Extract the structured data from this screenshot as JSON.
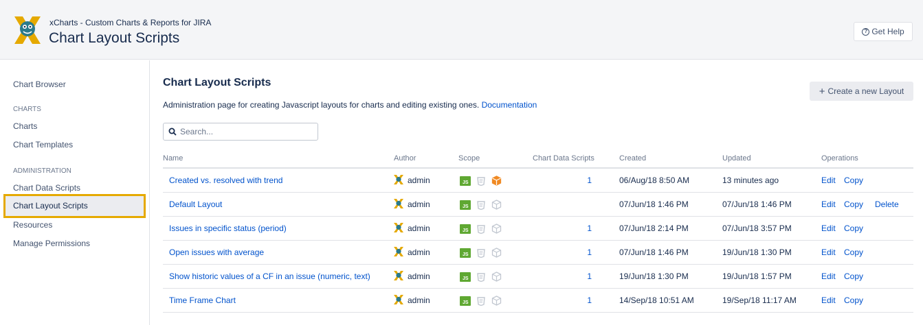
{
  "header": {
    "app_subtitle": "xCharts - Custom Charts & Reports for JIRA",
    "page_title": "Chart Layout Scripts",
    "help_label": "Get Help"
  },
  "sidebar": {
    "chart_browser": "Chart Browser",
    "section_charts": "CHARTS",
    "charts": "Charts",
    "chart_templates": "Chart Templates",
    "section_admin": "ADMINISTRATION",
    "chart_data_scripts": "Chart Data Scripts",
    "chart_layout_scripts": "Chart Layout Scripts",
    "resources": "Resources",
    "manage_permissions": "Manage Permissions"
  },
  "main": {
    "title": "Chart Layout Scripts",
    "description": "Administration page for creating Javascript layouts for charts and editing existing ones.",
    "doc_link": "Documentation",
    "create_label": "Create a new Layout",
    "search_placeholder": "Search..."
  },
  "table": {
    "columns": {
      "name": "Name",
      "author": "Author",
      "scope": "Scope",
      "data_scripts": "Chart Data Scripts",
      "created": "Created",
      "updated": "Updated",
      "operations": "Operations"
    },
    "rows": [
      {
        "name": "Created vs. resolved with trend",
        "author": "admin",
        "data_scripts": "1",
        "created": "06/Aug/18 8:50 AM",
        "updated": "13 minutes ago",
        "edit": "Edit",
        "copy": "Copy",
        "delete": "",
        "box_active": true
      },
      {
        "name": "Default Layout",
        "author": "admin",
        "data_scripts": "",
        "created": "07/Jun/18 1:46 PM",
        "updated": "07/Jun/18 1:46 PM",
        "edit": "Edit",
        "copy": "Copy",
        "delete": "Delete",
        "box_active": false
      },
      {
        "name": "Issues in specific status (period)",
        "author": "admin",
        "data_scripts": "1",
        "created": "07/Jun/18 2:14 PM",
        "updated": "07/Jun/18 3:57 PM",
        "edit": "Edit",
        "copy": "Copy",
        "delete": "",
        "box_active": false
      },
      {
        "name": "Open issues with average",
        "author": "admin",
        "data_scripts": "1",
        "created": "07/Jun/18 1:46 PM",
        "updated": "19/Jun/18 1:30 PM",
        "edit": "Edit",
        "copy": "Copy",
        "delete": "",
        "box_active": false
      },
      {
        "name": "Show historic values of a CF in an issue (numeric, text)",
        "author": "admin",
        "data_scripts": "1",
        "created": "19/Jun/18 1:30 PM",
        "updated": "19/Jun/18 1:57 PM",
        "edit": "Edit",
        "copy": "Copy",
        "delete": "",
        "box_active": false
      },
      {
        "name": "Time Frame Chart",
        "author": "admin",
        "data_scripts": "1",
        "created": "14/Sep/18 10:51 AM",
        "updated": "19/Sep/18 11:17 AM",
        "edit": "Edit",
        "copy": "Copy",
        "delete": "",
        "box_active": false
      }
    ]
  },
  "colors": {
    "link": "#0052cc",
    "active_highlight": "#e5a900",
    "js_green": "#5fa832",
    "box_orange": "#f08a24",
    "inactive_gray": "#c1c7d0"
  },
  "icons": {
    "logo": "xcharts-logo-icon",
    "help": "question-circle-icon",
    "search": "search-icon",
    "plus": "plus-icon",
    "avatar": "user-avatar-icon",
    "scope_js": "js-file-icon",
    "scope_css": "css-file-icon",
    "scope_box": "package-box-icon"
  }
}
